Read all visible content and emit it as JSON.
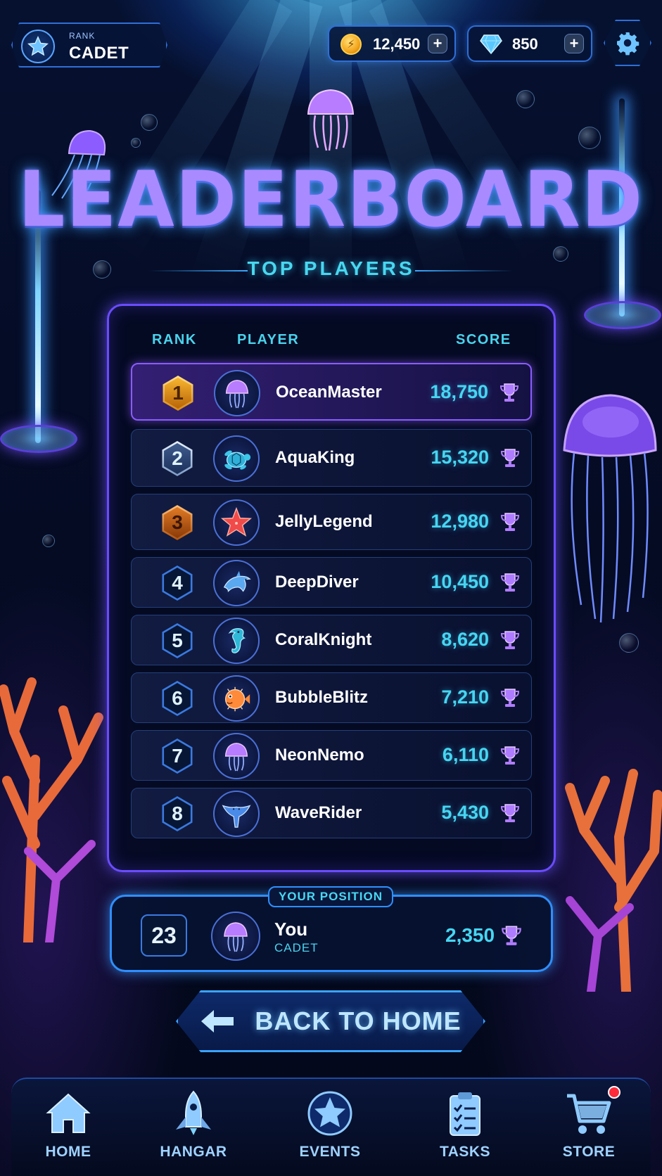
{
  "top_bar": {
    "rank_caption": "RANK",
    "rank_value": "CADET",
    "coins": "12,450",
    "gems": "850",
    "coin_icon": "coin-icon",
    "gem_icon": "diamond-icon",
    "settings_icon": "gear-icon"
  },
  "title": "LEADERBOARD",
  "subtitle": "TOP PLAYERS",
  "table": {
    "headers": {
      "rank": "RANK",
      "player": "PLAYER",
      "score": "SCORE"
    },
    "rows": [
      {
        "rank": "1",
        "name": "OceanMaster",
        "score": "18,750",
        "avatar": "jellyfish-icon",
        "medal": "gold"
      },
      {
        "rank": "2",
        "name": "AquaKing",
        "score": "15,320",
        "avatar": "turtle-icon",
        "medal": "silver"
      },
      {
        "rank": "3",
        "name": "JellyLegend",
        "score": "12,980",
        "avatar": "starfish-icon",
        "medal": "bronze"
      },
      {
        "rank": "4",
        "name": "DeepDiver",
        "score": "10,450",
        "avatar": "dolphin-icon",
        "medal": "none"
      },
      {
        "rank": "5",
        "name": "CoralKnight",
        "score": "8,620",
        "avatar": "seahorse-icon",
        "medal": "none"
      },
      {
        "rank": "6",
        "name": "BubbleBlitz",
        "score": "7,210",
        "avatar": "pufferfish-icon",
        "medal": "none"
      },
      {
        "rank": "7",
        "name": "NeonNemo",
        "score": "6,110",
        "avatar": "jellyfish-icon",
        "medal": "none"
      },
      {
        "rank": "8",
        "name": "WaveRider",
        "score": "5,430",
        "avatar": "manta-ray-icon",
        "medal": "none"
      }
    ]
  },
  "your_position": {
    "label": "YOUR POSITION",
    "rank": "23",
    "name": "You",
    "sub": "CADET",
    "score": "2,350",
    "avatar": "jellyfish-icon"
  },
  "back_button": "BACK TO HOME",
  "nav": [
    {
      "label": "HOME",
      "icon": "home-icon"
    },
    {
      "label": "HANGAR",
      "icon": "rocket-icon"
    },
    {
      "label": "EVENTS",
      "icon": "star-icon"
    },
    {
      "label": "TASKS",
      "icon": "clipboard-icon"
    },
    {
      "label": "STORE",
      "icon": "cart-icon",
      "has_notification": true
    }
  ],
  "colors": {
    "accent_cyan": "#46d6f2",
    "accent_purple": "#8a5cff",
    "frame_blue": "#2f8fff",
    "background": "#050c26"
  }
}
